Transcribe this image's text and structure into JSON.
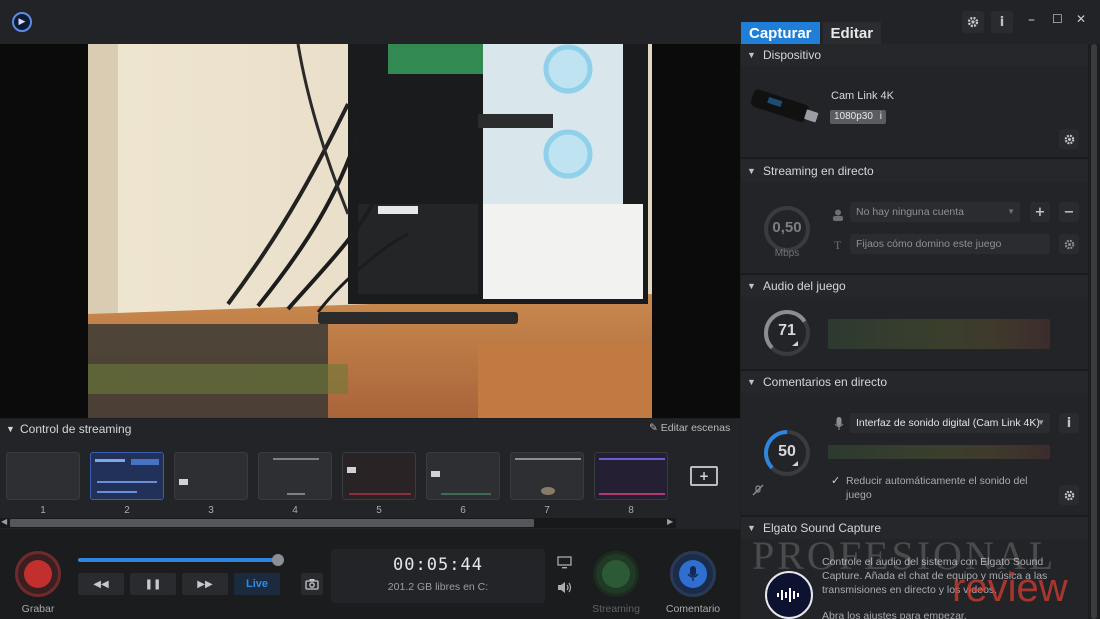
{
  "tabs": {
    "capture": "Capturar",
    "edit": "Editar"
  },
  "window": {
    "settings_icon": "gear-icon",
    "info_icon": "info-icon",
    "minimize": "–",
    "maximize": "☐",
    "close": "✕"
  },
  "device": {
    "header": "Dispositivo",
    "name": "Cam Link 4K",
    "resolution": "1080p30",
    "resolution_info": "i"
  },
  "streaming": {
    "header": "Streaming en directo",
    "bitrate_value": "0,50",
    "bitrate_unit": "Mbps",
    "account_placeholder": "No hay ninguna cuenta",
    "title_placeholder": "Fijaos cómo domino este juego",
    "add_label": "+",
    "remove_label": "−"
  },
  "game_audio": {
    "header": "Audio del juego",
    "level": "71",
    "level_fraction": 0.71
  },
  "commentary": {
    "header": "Comentarios en directo",
    "level": "50",
    "level_fraction": 0.5,
    "input_device": "Interfaz de sonido digital (Cam Link 4K)",
    "info_icon": "i",
    "reduce_label_line1": "Reducir automáticamente el sonido del",
    "reduce_label_line2": "juego"
  },
  "sound_capture": {
    "header": "Elgato Sound Capture",
    "desc_line1": "Controle el audio del sistema con Elgato Sound",
    "desc_line2": "Capture. Añada el chat de equipo y música a las",
    "desc_line3": "transmisiones en directo y los vídeos.",
    "desc_line4": "Abra los ajustes para empezar."
  },
  "stream_control": {
    "header": "Control de streaming",
    "edit_scenes": "Editar escenas",
    "scenes": [
      {
        "num": "1"
      },
      {
        "num": "2"
      },
      {
        "num": "3"
      },
      {
        "num": "4"
      },
      {
        "num": "5"
      },
      {
        "num": "6"
      },
      {
        "num": "7"
      },
      {
        "num": "8"
      }
    ]
  },
  "transport": {
    "record_label": "Grabar",
    "rewind": "◀◀",
    "pause": "❚❚",
    "forward": "▶▶",
    "live": "Live",
    "progress_fraction": 0.98,
    "timer": "00:05:44",
    "free_space": "201.2 GB libres en C:",
    "streaming_label": "Streaming",
    "commentary_label": "Comentario"
  },
  "watermark": {
    "line1": "PROFESIONAL",
    "line2": "review"
  },
  "colors": {
    "accent": "#1f7fd8",
    "record": "#c22f2f",
    "commentary": "#2f6fd0",
    "streaming_disabled": "#2d5a36"
  }
}
